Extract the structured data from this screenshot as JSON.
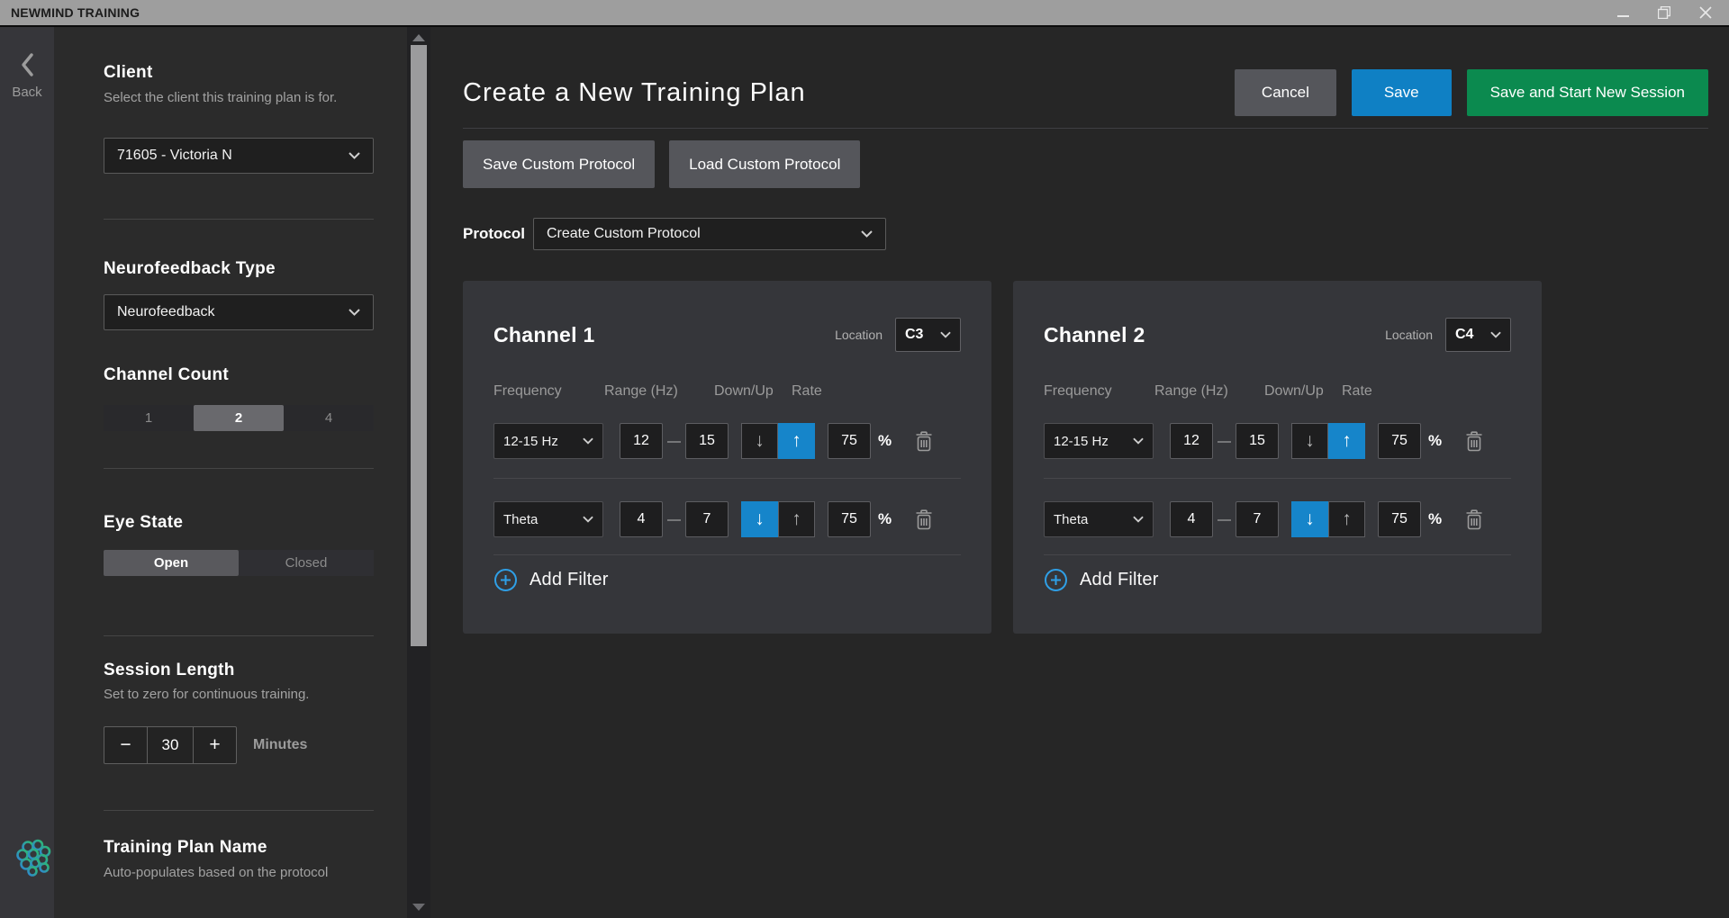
{
  "titlebar": {
    "title": "NEWMIND TRAINING"
  },
  "back_button": {
    "label": "Back"
  },
  "sidebar": {
    "client": {
      "heading": "Client",
      "description": "Select the client this training plan is for.",
      "selected_value": "71605 - Victoria N"
    },
    "neurofeedback_type": {
      "heading": "Neurofeedback Type",
      "selected_value": "Neurofeedback"
    },
    "channel_count": {
      "heading": "Channel Count",
      "options": [
        "1",
        "2",
        "4"
      ],
      "selected": "2"
    },
    "eye_state": {
      "heading": "Eye State",
      "options": [
        "Open",
        "Closed"
      ],
      "selected": "Open"
    },
    "session_length": {
      "heading": "Session Length",
      "description": "Set to zero for continuous training.",
      "minus_label": "−",
      "value": "30",
      "plus_label": "+",
      "units_label": "Minutes"
    },
    "training_plan_name": {
      "heading": "Training Plan Name",
      "description": "Auto-populates based on the protocol"
    }
  },
  "main": {
    "title": "Create a New Training Plan",
    "actions": {
      "cancel": "Cancel",
      "save": "Save",
      "save_and_start": "Save and Start New Session"
    },
    "protocol_toolbar": {
      "save_custom": "Save Custom Protocol",
      "load_custom": "Load Custom Protocol"
    },
    "protocol": {
      "label": "Protocol",
      "selected_value": "Create Custom Protocol"
    },
    "columns": {
      "frequency": "Frequency",
      "range": "Range (Hz)",
      "down_up": "Down/Up",
      "rate": "Rate"
    },
    "add_filter_label": "Add Filter",
    "channels": [
      {
        "title": "Channel 1",
        "location_label": "Location",
        "location_value": "C3",
        "filters": [
          {
            "frequency": "12-15 Hz",
            "range_low": "12",
            "range_high": "15",
            "selected_direction": "up",
            "rate": "75",
            "rate_unit": "%"
          },
          {
            "frequency": "Theta",
            "range_low": "4",
            "range_high": "7",
            "selected_direction": "down",
            "rate": "75",
            "rate_unit": "%"
          }
        ]
      },
      {
        "title": "Channel 2",
        "location_label": "Location",
        "location_value": "C4",
        "filters": [
          {
            "frequency": "12-15 Hz",
            "range_low": "12",
            "range_high": "15",
            "selected_direction": "up",
            "rate": "75",
            "rate_unit": "%"
          },
          {
            "frequency": "Theta",
            "range_low": "4",
            "range_high": "7",
            "selected_direction": "down",
            "rate": "75",
            "rate_unit": "%"
          }
        ]
      }
    ]
  },
  "icons": {
    "down_arrow": "↓",
    "up_arrow": "↑",
    "range_separator": "—"
  },
  "colors": {
    "titlebar": "#9e9e9e",
    "sidebar": "#2b2b2b",
    "page": "#262626",
    "card": "#35363a",
    "accent_blue": "#0f80c4",
    "accent_green": "#0b8a4f",
    "arrow_active_blue": "#1685ca",
    "add_filter_blue": "#2f9fe6",
    "logo_gradient_start": "#2e86d3",
    "logo_gradient_end": "#2dbb6e"
  }
}
